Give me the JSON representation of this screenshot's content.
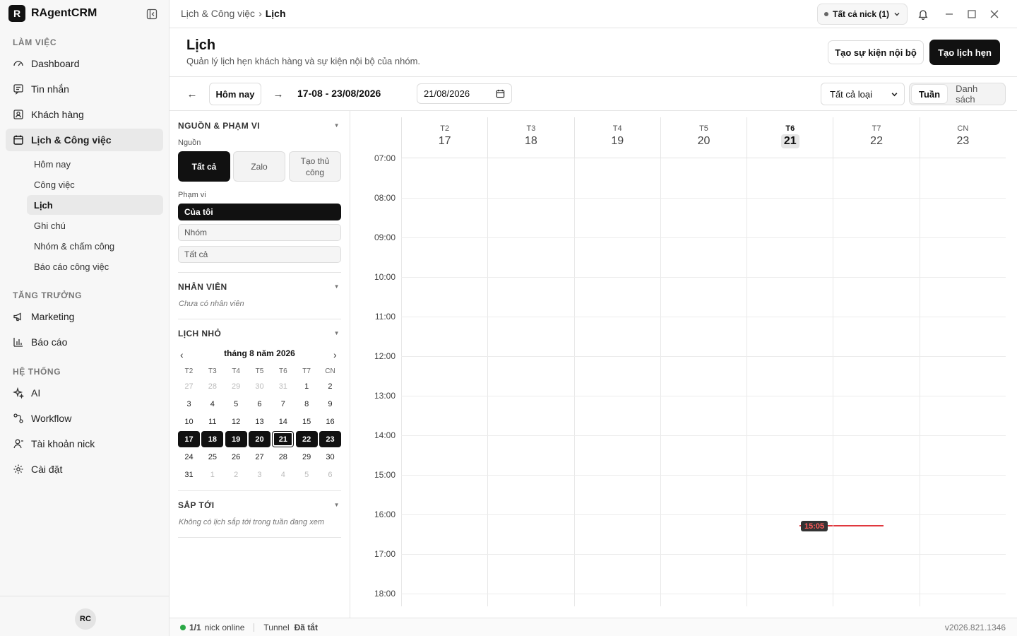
{
  "app": {
    "logo_letter": "R",
    "name": "RAgentCRM"
  },
  "sidebar": {
    "sections": [
      {
        "label": "LÀM VIỆC"
      },
      {
        "label": "TĂNG TRƯỞNG"
      },
      {
        "label": "HỆ THỐNG"
      }
    ],
    "items": {
      "dashboard": "Dashboard",
      "messages": "Tin nhắn",
      "customers": "Khách hàng",
      "calendar_tasks": "Lịch & Công việc",
      "marketing": "Marketing",
      "reports": "Báo cáo",
      "ai": "AI",
      "workflow": "Workflow",
      "nick_accounts": "Tài khoản nick",
      "settings": "Cài đặt"
    },
    "sub_items": [
      "Hôm nay",
      "Công việc",
      "Lịch",
      "Ghi chú",
      "Nhóm & chấm công",
      "Báo cáo công việc"
    ],
    "avatar": "RC"
  },
  "topbar": {
    "breadcrumb_parent": "Lịch & Công việc",
    "breadcrumb_sep": "›",
    "breadcrumb_current": "Lịch",
    "nick_select": "Tất cả nick (1)"
  },
  "header": {
    "title": "Lịch",
    "subtitle": "Quản lý lịch hẹn khách hàng và sự kiện nội bộ của nhóm.",
    "btn_internal": "Tạo sự kiện nội bộ",
    "btn_appointment": "Tạo lịch hẹn"
  },
  "toolbar": {
    "prev": "←",
    "today": "Hôm nay",
    "next": "→",
    "range": "17-08 - 23/08/2026",
    "date_value": "21/08/2026",
    "type_select": "Tất cả loại",
    "view_week": "Tuần",
    "view_list": "Danh sách"
  },
  "filters": {
    "source_title": "NGUỒN & PHẠM VI",
    "source_label": "Nguồn",
    "source_options": [
      "Tất cả",
      "Zalo",
      "Tạo thủ công"
    ],
    "scope_label": "Phạm vi",
    "scope_options": [
      "Của tôi",
      "Nhóm",
      "Tất cả"
    ],
    "staff_title": "NHÂN VIÊN",
    "staff_empty": "Chưa có nhân viên",
    "mini_title": "LỊCH NHỎ",
    "mini_month": "tháng 8 năm 2026",
    "mini_dows": [
      "T2",
      "T3",
      "T4",
      "T5",
      "T6",
      "T7",
      "CN"
    ],
    "mini_days": [
      {
        "d": "27",
        "m": true
      },
      {
        "d": "28",
        "m": true
      },
      {
        "d": "29",
        "m": true
      },
      {
        "d": "30",
        "m": true
      },
      {
        "d": "31",
        "m": true
      },
      {
        "d": "1"
      },
      {
        "d": "2"
      },
      {
        "d": "3"
      },
      {
        "d": "4"
      },
      {
        "d": "5"
      },
      {
        "d": "6"
      },
      {
        "d": "7"
      },
      {
        "d": "8"
      },
      {
        "d": "9"
      },
      {
        "d": "10"
      },
      {
        "d": "11"
      },
      {
        "d": "12"
      },
      {
        "d": "13"
      },
      {
        "d": "14"
      },
      {
        "d": "15"
      },
      {
        "d": "16"
      },
      {
        "d": "17",
        "s": true
      },
      {
        "d": "18",
        "s": true
      },
      {
        "d": "19",
        "s": true
      },
      {
        "d": "20",
        "s": true
      },
      {
        "d": "21",
        "s": true,
        "t": true
      },
      {
        "d": "22",
        "s": true
      },
      {
        "d": "23",
        "s": true
      },
      {
        "d": "24"
      },
      {
        "d": "25"
      },
      {
        "d": "26"
      },
      {
        "d": "27"
      },
      {
        "d": "28"
      },
      {
        "d": "29"
      },
      {
        "d": "30"
      },
      {
        "d": "31"
      },
      {
        "d": "1",
        "m": true
      },
      {
        "d": "2",
        "m": true
      },
      {
        "d": "3",
        "m": true
      },
      {
        "d": "4",
        "m": true
      },
      {
        "d": "5",
        "m": true
      },
      {
        "d": "6",
        "m": true
      }
    ],
    "upcoming_title": "SẮP TỚI",
    "upcoming_empty": "Không có lịch sắp tới trong tuần đang xem"
  },
  "calendar": {
    "days": [
      {
        "dow": "T2",
        "num": "17"
      },
      {
        "dow": "T3",
        "num": "18"
      },
      {
        "dow": "T4",
        "num": "19"
      },
      {
        "dow": "T5",
        "num": "20"
      },
      {
        "dow": "T6",
        "num": "21",
        "today": true
      },
      {
        "dow": "T7",
        "num": "22"
      },
      {
        "dow": "CN",
        "num": "23"
      }
    ],
    "hours": [
      "07:00",
      "08:00",
      "09:00",
      "10:00",
      "11:00",
      "12:00",
      "13:00",
      "14:00",
      "15:00",
      "16:00",
      "17:00",
      "18:00"
    ],
    "now_label": "15:05",
    "now_color": "#e0383e"
  },
  "statusbar": {
    "online_count": "1/1",
    "online_text": "nick online",
    "tunnel_label": "Tunnel",
    "tunnel_status": "Đã tắt",
    "version": "v2026.821.1346"
  }
}
